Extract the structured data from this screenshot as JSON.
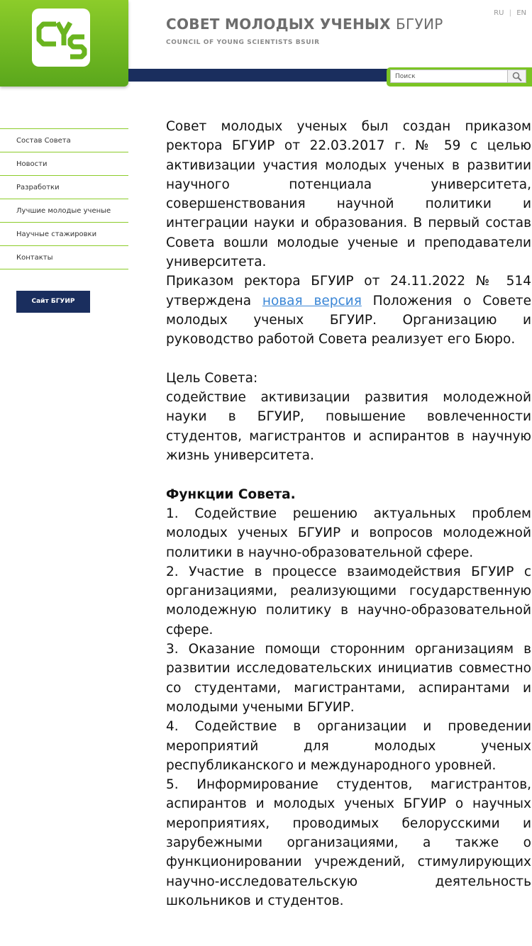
{
  "header": {
    "title_bold": "СОВЕТ МОЛОДЫХ УЧЕНЫХ",
    "title_light": "БГУИР",
    "subtitle": "COUNCIL OF YOUNG SCIENTISTS BSUIR",
    "lang_ru": "RU",
    "lang_sep": "|",
    "lang_en": "EN",
    "logo_icon": "cys-logo-icon",
    "colors": {
      "green": "#7bc424",
      "navy": "#1a2e5e",
      "link": "#3a86d6"
    }
  },
  "search": {
    "placeholder": "Поиск",
    "icon": "search-icon"
  },
  "sidebar": {
    "items": [
      {
        "label": "Состав Совета"
      },
      {
        "label": "Новости"
      },
      {
        "label": "Разработки"
      },
      {
        "label": "Лучшие молодые ученые"
      },
      {
        "label": "Научные стажировки"
      },
      {
        "label": "Контакты"
      }
    ],
    "site_button": "Сайт БГУИР"
  },
  "content": {
    "p1": "Совет молодых ученых был создан приказом ректора БГУИР от 22.03.2017 г. № 59 с целью активизации участия молодых ученых в развитии научного потенциала университета, совершенствования научной политики и интеграции науки и образования. В первый состав Совета вошли молодые ученые и преподаватели университета.",
    "p2_before": "Приказом ректора БГУИР от 24.11.2022 № 514 утверждена ",
    "p2_link": "новая версия",
    "p2_after": " Положения о Совете молодых ученых БГУИР. Организацию и руководство работой Совета реализует его Бюро.",
    "goal_heading": "Цель Совета:",
    "goal_text": "содействие активизации развития молодежной науки в БГУИР, повышение вовлеченности студентов, магистрантов и аспирантов в научную жизнь университета.",
    "functions_heading": "Функции Совета.",
    "functions": [
      "1. Содействие решению актуальных проблем молодых ученых БГУИР и вопросов молодежной политики в научно-образовательной сфере.",
      "2. Участие в процессе взаимодействия БГУИР с организациями, реализующими государственную молодежную политику в научно-образовательной сфере.",
      "3. Оказание помощи сторонним организациям в развитии исследовательских инициатив совместно со студентами, магистрантами, аспирантами и молодыми учеными БГУИР.",
      "4. Содействие в организации и проведении мероприятий для молодых ученых республиканского и международного уровней.",
      "5. Информирование студентов, магистрантов, аспирантов и молодых ученых БГУИР о научных мероприятиях, проводимых белорусскими и зарубежными организациями, а также о функционировании учреждений, стимулирующих научно-исследовательскую деятельность школьников и студентов."
    ]
  }
}
